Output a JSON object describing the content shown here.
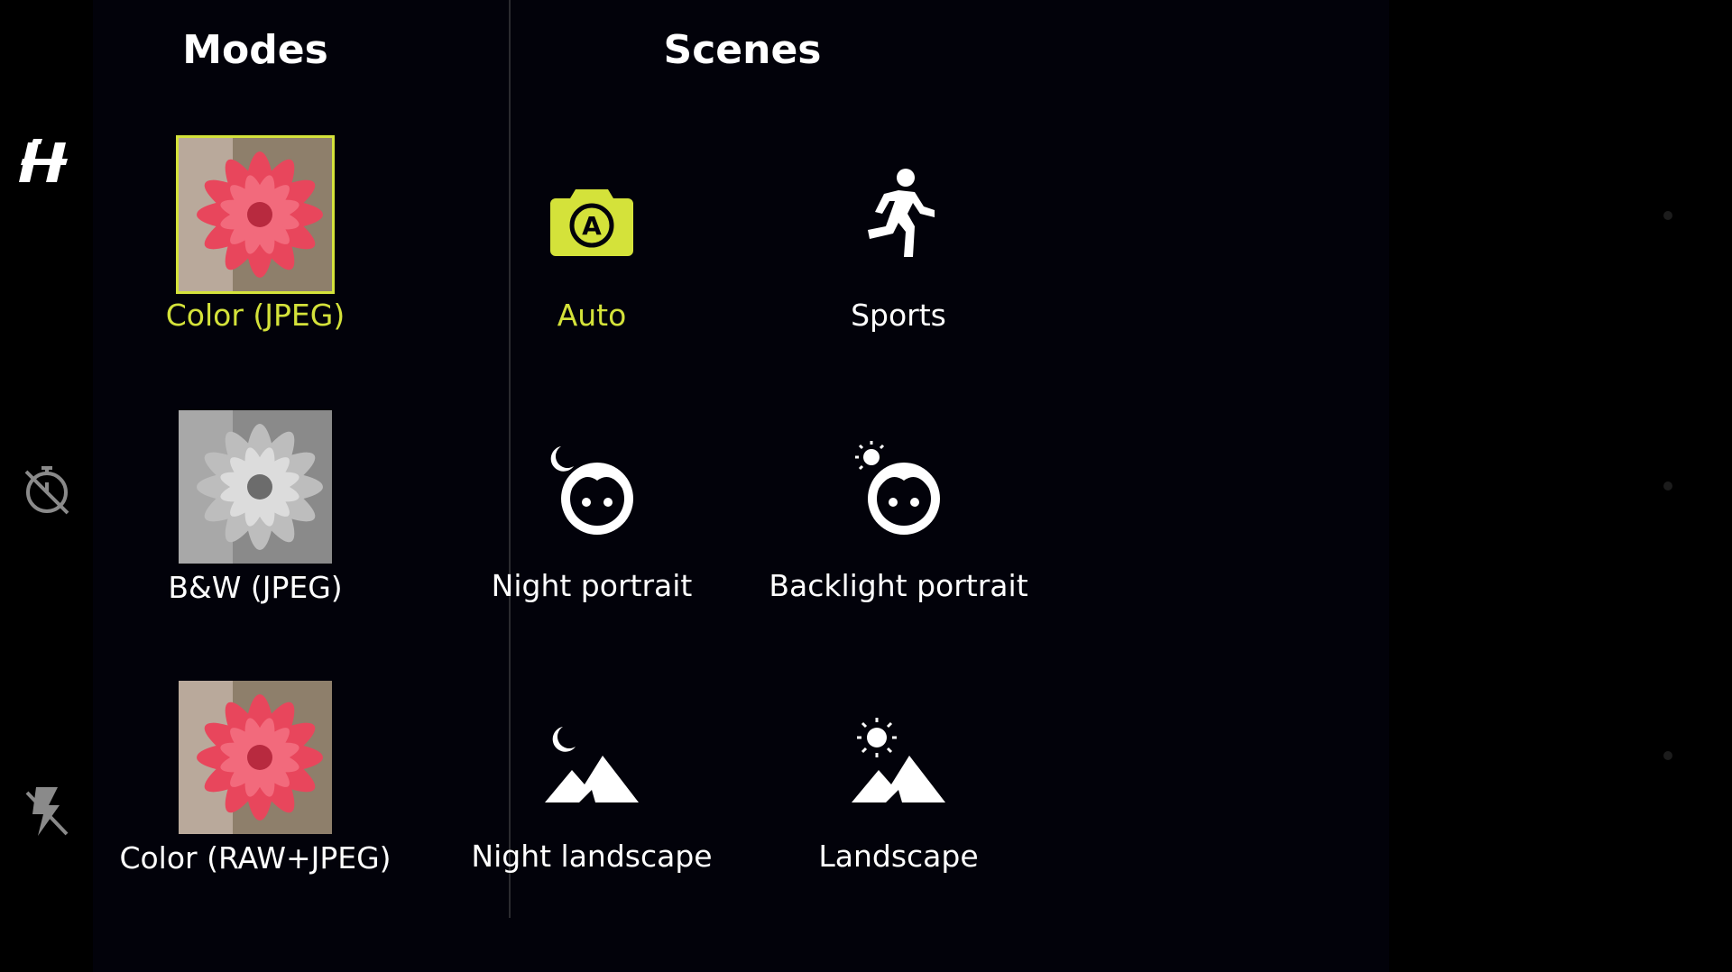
{
  "modes": {
    "title": "Modes",
    "items": [
      {
        "label": "Color (JPEG)",
        "selected": true,
        "style": "color"
      },
      {
        "label": "B&W (JPEG)",
        "selected": false,
        "style": "bw"
      },
      {
        "label": "Color (RAW+JPEG)",
        "selected": false,
        "style": "color"
      }
    ]
  },
  "scenes": {
    "title": "Scenes",
    "items": [
      {
        "label": "Auto",
        "icon": "auto-camera-icon",
        "selected": true
      },
      {
        "label": "Sports",
        "icon": "running-person-icon",
        "selected": false
      },
      {
        "label": "Night portrait",
        "icon": "night-portrait-icon",
        "selected": false
      },
      {
        "label": "Backlight portrait",
        "icon": "backlight-portrait-icon",
        "selected": false
      },
      {
        "label": "Night landscape",
        "icon": "night-landscape-icon",
        "selected": false
      },
      {
        "label": "Landscape",
        "icon": "landscape-icon",
        "selected": false
      }
    ]
  },
  "rail": {
    "icons": [
      "hasselblad-logo-icon",
      "timer-off-icon",
      "flash-off-icon"
    ]
  },
  "colors": {
    "accent": "#d4e23a",
    "background": "#02020a"
  }
}
